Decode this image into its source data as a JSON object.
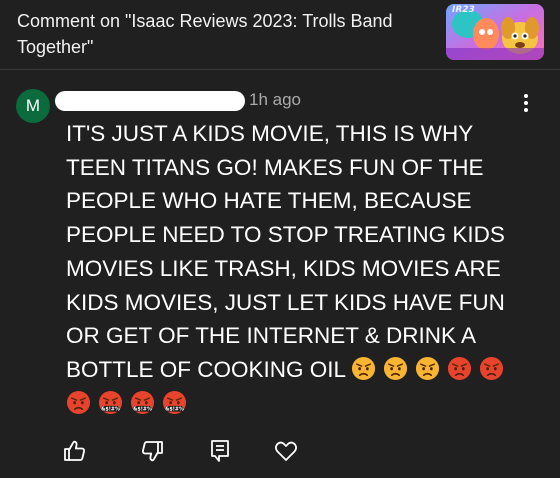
{
  "header": {
    "title": "Comment on \"Isaac Reviews 2023: Trolls Band Together\"",
    "thumbnail": {
      "label": "IR23",
      "icon": "video-thumbnail"
    }
  },
  "comment": {
    "avatar_letter": "M",
    "timestamp": "1h ago",
    "text": "IT'S JUST A KIDS MOVIE, THIS IS WHY TEEN TITANS GO! MAKES FUN OF THE PEOPLE WHO HATE THEM, BECAUSE PEOPLE NEED TO STOP TREATING KIDS MOVIES LIKE TRASH, KIDS MOVIES ARE KIDS MOVIES, JUST LET KIDS HAVE FUN OR GET OF THE INTERNET & DRINK A BOTTLE OF COOKING OIL",
    "emojis": [
      "angry-face",
      "angry-face",
      "angry-face",
      "pouting-face",
      "pouting-face",
      "pouting-face",
      "cursing-face",
      "cursing-face",
      "cursing-face"
    ],
    "cursing_symbols": "&$!#%"
  },
  "actions": [
    "thumbs-up-icon",
    "thumbs-down-icon",
    "reply-icon",
    "heart-icon"
  ],
  "colors": {
    "background": "#202020",
    "avatar": "#0b6b3c",
    "timestamp": "#aaaaaa",
    "angry_face": "#f7b531",
    "pouting_face": "#e8432c"
  }
}
